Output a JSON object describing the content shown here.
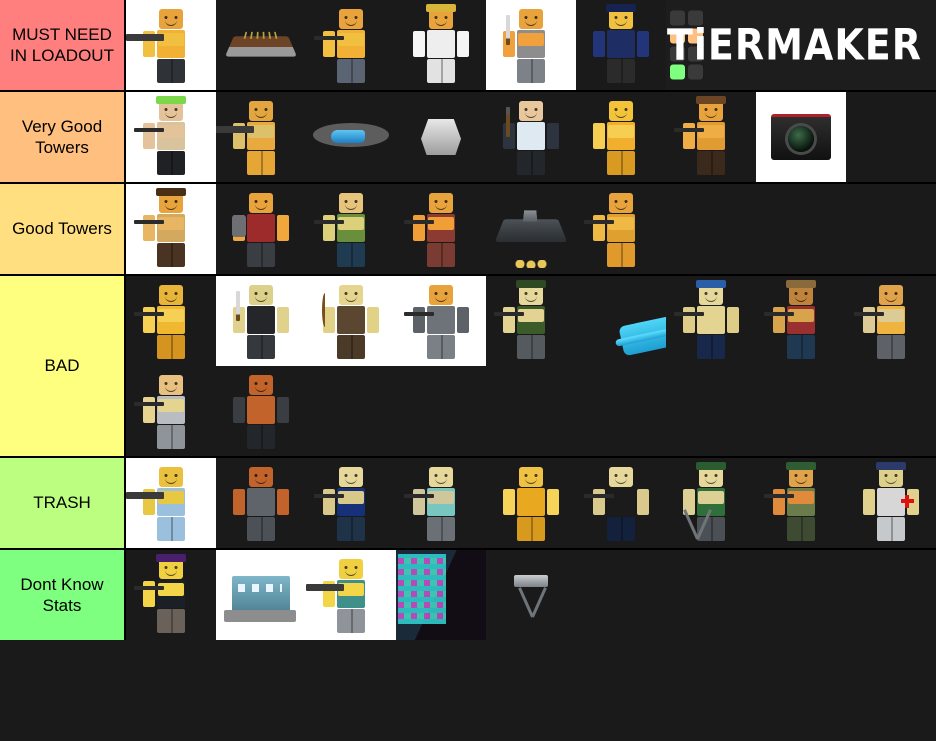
{
  "app": {
    "name": "TierMaker",
    "logo_text": "TiERMAKER",
    "logo_swatch_colors": [
      "#3a3a3a",
      "#3a3a3a",
      "#ffbf7f",
      "#ffbf7f",
      "#3a3a3a",
      "#3a3a3a",
      "#7fff7f",
      "#3a3a3a"
    ],
    "background": "#1a1a1a"
  },
  "tiers": [
    {
      "label": "MUST NEED IN LOADOUT",
      "color": "#ff7f7f",
      "items": [
        {
          "name": "minigunner-tower",
          "bg": "white",
          "kind": "figure",
          "skin": "#e8a33d",
          "torso": "#f2b134",
          "arm": "#f2c040",
          "legs": "#2f3338",
          "arm_pose": "fwd",
          "weapon": "minigun",
          "hat": ""
        },
        {
          "name": "farm-tower",
          "bg": "dark",
          "kind": "farm"
        },
        {
          "name": "sniper-tropper-tower",
          "bg": "dark",
          "kind": "figure",
          "skin": "#e8a33d",
          "torso": "#f2b134",
          "arm": "#f2c040",
          "legs": "#5a6472",
          "arm_pose": "fwd",
          "weapon": "tripod-gun",
          "hat": ""
        },
        {
          "name": "medic-commander-tower",
          "bg": "dark",
          "kind": "figure",
          "skin": "#e8a33d",
          "torso": "#eeeeee",
          "arm": "#f5f5f5",
          "legs": "#e2e2e2",
          "arm_pose": "side",
          "weapon": "",
          "hat": "#d9b43a"
        },
        {
          "name": "swordsman-tower",
          "bg": "white",
          "kind": "figure",
          "skin": "#e8a33d",
          "torso": "#8d8d8d",
          "arm": "#f0a03c",
          "legs": "#7d8289",
          "arm_pose": "fwd",
          "weapon": "blade",
          "hat": ""
        },
        {
          "name": "commander-tower",
          "bg": "dark",
          "kind": "figure",
          "skin": "#f0c040",
          "torso": "#1e2d63",
          "arm": "#22357a",
          "legs": "#2b2b2b",
          "arm_pose": "side",
          "weapon": "",
          "hat": "#16224f"
        }
      ],
      "show_logo": true
    },
    {
      "label": "Very Good Towers",
      "color": "#ffbf7f",
      "items": [
        {
          "name": "soldier-tower",
          "bg": "white",
          "kind": "figure",
          "skin": "#e4c39a",
          "torso": "#d8c39c",
          "arm": "#e4c39a",
          "legs": "#1f2124",
          "arm_pose": "fwd",
          "weapon": "rifle",
          "hat": "#7bd84a"
        },
        {
          "name": "gatling-gunner-tower",
          "bg": "dark",
          "kind": "figure",
          "skin": "#e2a53f",
          "torso": "#e8a93e",
          "arm": "#ddc06a",
          "legs": "#e5a636",
          "arm_pose": "fwd",
          "weapon": "gatling",
          "hat": ""
        },
        {
          "name": "helicopter-tower",
          "bg": "dark",
          "kind": "helicopter"
        },
        {
          "name": "turret-tower",
          "bg": "dark",
          "kind": "turret"
        },
        {
          "name": "frost-blaster-tower",
          "bg": "dark",
          "kind": "figure",
          "skin": "#e8c79c",
          "torso": "#dfe9f2",
          "arm": "#2d3440",
          "legs": "#23272c",
          "arm_pose": "side",
          "weapon": "hammer",
          "hat": ""
        },
        {
          "name": "golden-crook-boss-tower",
          "bg": "dark",
          "kind": "figure",
          "skin": "#f3c43a",
          "torso": "#f0b02e",
          "arm": "#f6cf52",
          "legs": "#d99a22",
          "arm_pose": "fwd",
          "weapon": "",
          "hat": ""
        },
        {
          "name": "cowboy-tower",
          "bg": "dark",
          "kind": "figure",
          "skin": "#e8a33d",
          "torso": "#e09b33",
          "arm": "#eeae45",
          "legs": "#3b2a1c",
          "arm_pose": "fwd",
          "weapon": "pistol",
          "hat": "#6b4524"
        },
        {
          "name": "accelerator-tower",
          "bg": "white",
          "kind": "camera"
        }
      ],
      "show_logo": false
    },
    {
      "label": "Good Towers",
      "color": "#ffdf7f",
      "items": [
        {
          "name": "ranger-cowboy-tower",
          "bg": "white",
          "kind": "figure",
          "skin": "#e8a33d",
          "torso": "#d2a95f",
          "arm": "#e8b562",
          "legs": "#4a3322",
          "arm_pose": "fwd",
          "weapon": "pistol",
          "hat": "#4a2f16"
        },
        {
          "name": "pyromancer-tower",
          "bg": "dark",
          "kind": "figure",
          "skin": "#e8a33d",
          "torso": "#9e2b2b",
          "arm": "#f0a83c",
          "legs": "#3a3d42",
          "arm_pose": "side",
          "weapon": "backpack",
          "hat": ""
        },
        {
          "name": "scout-tower",
          "bg": "dark",
          "kind": "figure",
          "skin": "#e7c47c",
          "torso": "#6a8f3c",
          "arm": "#dcd07a",
          "legs": "#1f3b52",
          "arm_pose": "fwd",
          "weapon": "smg",
          "hat": ""
        },
        {
          "name": "shotgunner-tower",
          "bg": "dark",
          "kind": "figure",
          "skin": "#e8a33d",
          "torso": "#8c3b33",
          "arm": "#ef9f35",
          "legs": "#7a3b33",
          "arm_pose": "fwd",
          "weapon": "shotgun",
          "hat": ""
        },
        {
          "name": "military-base-tower",
          "bg": "dark",
          "kind": "base"
        },
        {
          "name": "hunter-tower",
          "bg": "dark",
          "kind": "figure",
          "skin": "#e8a33d",
          "torso": "#e0a030",
          "arm": "#f0b845",
          "legs": "#e09a2c",
          "arm_pose": "fwd",
          "weapon": "crossbow",
          "hat": ""
        }
      ],
      "show_logo": false
    },
    {
      "label": "BAD",
      "color": "#ffff7f",
      "items": [
        {
          "name": "golden-scout-tower",
          "bg": "dark",
          "kind": "figure",
          "skin": "#e8b43a",
          "torso": "#f0b830",
          "arm": "#f6d055",
          "legs": "#d4941f",
          "arm_pose": "fwd",
          "weapon": "smg",
          "hat": ""
        },
        {
          "name": "swordmaster-tower",
          "bg": "white",
          "kind": "figure",
          "skin": "#ddd08a",
          "torso": "#24262a",
          "arm": "#e0d18c",
          "legs": "#35383d",
          "arm_pose": "side",
          "weapon": "blade",
          "hat": ""
        },
        {
          "name": "archer-tower",
          "bg": "white",
          "kind": "figure",
          "skin": "#e5d58f",
          "torso": "#5a4631",
          "arm": "#e2d288",
          "legs": "#4c3a28",
          "arm_pose": "side",
          "weapon": "bow",
          "hat": ""
        },
        {
          "name": "demoman-tower",
          "bg": "white",
          "kind": "figure",
          "skin": "#e8a33d",
          "torso": "#6e7379",
          "arm": "#5d6268",
          "legs": "#7b8087",
          "arm_pose": "side",
          "weapon": "grenade",
          "hat": ""
        },
        {
          "name": "military-soldier-tower",
          "bg": "dark",
          "kind": "figure",
          "skin": "#e6d79a",
          "torso": "#3c5b2b",
          "arm": "#e2d392",
          "legs": "#545a5e",
          "arm_pose": "fwd",
          "weapon": "rifle",
          "hat": "#2f4a22"
        },
        {
          "name": "biplane-tower",
          "bg": "dark",
          "kind": "plane"
        },
        {
          "name": "paintballer-tower",
          "bg": "dark",
          "kind": "figure",
          "skin": "#e6d79a",
          "torso": "#e3d492",
          "arm": "#ddcd86",
          "legs": "#18284a",
          "arm_pose": "side",
          "weapon": "smg",
          "hat": "#2a5fa8"
        },
        {
          "name": "militant-tower",
          "bg": "dark",
          "kind": "figure",
          "skin": "#c0833c",
          "torso": "#9a2f30",
          "arm": "#d7a44c",
          "legs": "#1f3952",
          "arm_pose": "fwd",
          "weapon": "rifle",
          "hat": "#8a6a3a"
        },
        {
          "name": "gunner-tower",
          "bg": "dark",
          "kind": "figure",
          "skin": "#e0a24a",
          "torso": "#eeb43f",
          "arm": "#dccb95",
          "legs": "#5e6268",
          "arm_pose": "fwd",
          "weapon": "rifle",
          "hat": ""
        },
        {
          "name": "gunslinger-tower",
          "bg": "dark",
          "kind": "figure",
          "skin": "#e8c080",
          "torso": "#b9bcc0",
          "arm": "#e4d48f",
          "legs": "#8e949a",
          "arm_pose": "fwd",
          "weapon": "pistol",
          "hat": ""
        },
        {
          "name": "brawler-tower",
          "bg": "dark",
          "kind": "figure",
          "skin": "#c2632c",
          "torso": "#c2632c",
          "arm": "#3a3d42",
          "legs": "#23262a",
          "arm_pose": "side",
          "weapon": "",
          "hat": ""
        }
      ],
      "show_logo": false
    },
    {
      "label": "TRASH",
      "color": "#bcff80",
      "items": [
        {
          "name": "rocketeer-tower",
          "bg": "white",
          "kind": "figure",
          "skin": "#e9c13f",
          "torso": "#9bc0de",
          "arm": "#e8c843",
          "legs": "#9bc0de",
          "arm_pose": "fwd",
          "weapon": "launcher",
          "hat": ""
        },
        {
          "name": "crook-boss-tower",
          "bg": "dark",
          "kind": "figure",
          "skin": "#c2632c",
          "torso": "#5f646a",
          "arm": "#c2632c",
          "legs": "#4c5157",
          "arm_pose": "side",
          "weapon": "",
          "hat": ""
        },
        {
          "name": "freezer-tower",
          "bg": "dark",
          "kind": "figure",
          "skin": "#e6d79a",
          "torso": "#17307a",
          "arm": "#d8c98a",
          "legs": "#1e3348",
          "arm_pose": "fwd",
          "weapon": "freeze-gun",
          "hat": ""
        },
        {
          "name": "electroshocker-tower",
          "bg": "dark",
          "kind": "figure",
          "skin": "#e6d79a",
          "torso": "#77c6c0",
          "arm": "#cfc69c",
          "legs": "#6b7076",
          "arm_pose": "fwd",
          "weapon": "shock-gun",
          "hat": ""
        },
        {
          "name": "golden-pyromancer-tower",
          "bg": "dark",
          "kind": "figure",
          "skin": "#f0c244",
          "torso": "#e8a81f",
          "arm": "#f6d45a",
          "legs": "#d89a1c",
          "arm_pose": "side",
          "weapon": "",
          "hat": ""
        },
        {
          "name": "mobster-tower",
          "bg": "dark",
          "kind": "figure",
          "skin": "#e6d79a",
          "torso": "#1b1b1b",
          "arm": "#d9c98c",
          "legs": "#14213c",
          "arm_pose": "side",
          "weapon": "tommy-gun",
          "hat": ""
        },
        {
          "name": "dj-booth-tower",
          "bg": "dark",
          "kind": "figure",
          "skin": "#e6d79a",
          "torso": "#2f6f3a",
          "arm": "#ddd094",
          "legs": "#4a5056",
          "arm_pose": "fwd",
          "weapon": "tripod",
          "hat": "#2a5c30"
        },
        {
          "name": "military-base-soldier-tower",
          "bg": "dark",
          "kind": "figure",
          "skin": "#e0a24a",
          "torso": "#6a7c4a",
          "arm": "#e08a3c",
          "legs": "#3f4a32",
          "arm_pose": "fwd",
          "weapon": "rifle",
          "hat": "#2e5c33"
        },
        {
          "name": "medic-tower",
          "bg": "dark",
          "kind": "figure",
          "skin": "#ddd08a",
          "torso": "#d7d7d7",
          "arm": "#e0d28c",
          "legs": "#c5c9cc",
          "arm_pose": "side",
          "weapon": "medic",
          "hat": "#2b3a6b"
        }
      ],
      "show_logo": false
    },
    {
      "label": "Dont Know Stats",
      "color": "#7fff7f",
      "items": [
        {
          "name": "engineer-tower",
          "bg": "dark",
          "kind": "figure",
          "skin": "#f0d040",
          "torso": "#1b1f26",
          "arm": "#f2d648",
          "legs": "#6a625a",
          "arm_pose": "fwd",
          "weapon": "wrench",
          "hat": "#4a1f6b"
        },
        {
          "name": "factory-building",
          "bg": "white",
          "kind": "building"
        },
        {
          "name": "military-engineer-tower",
          "bg": "white",
          "kind": "figure",
          "skin": "#f0d040",
          "torso": "#3f8f8a",
          "arm": "#f2d648",
          "legs": "#8e949a",
          "arm_pose": "fwd",
          "weapon": "drill",
          "hat": ""
        },
        {
          "name": "neon-city-map",
          "bg": "dark",
          "kind": "city"
        },
        {
          "name": "turret-deployable",
          "bg": "dark",
          "kind": "tripod-turret"
        }
      ],
      "show_logo": false
    }
  ]
}
